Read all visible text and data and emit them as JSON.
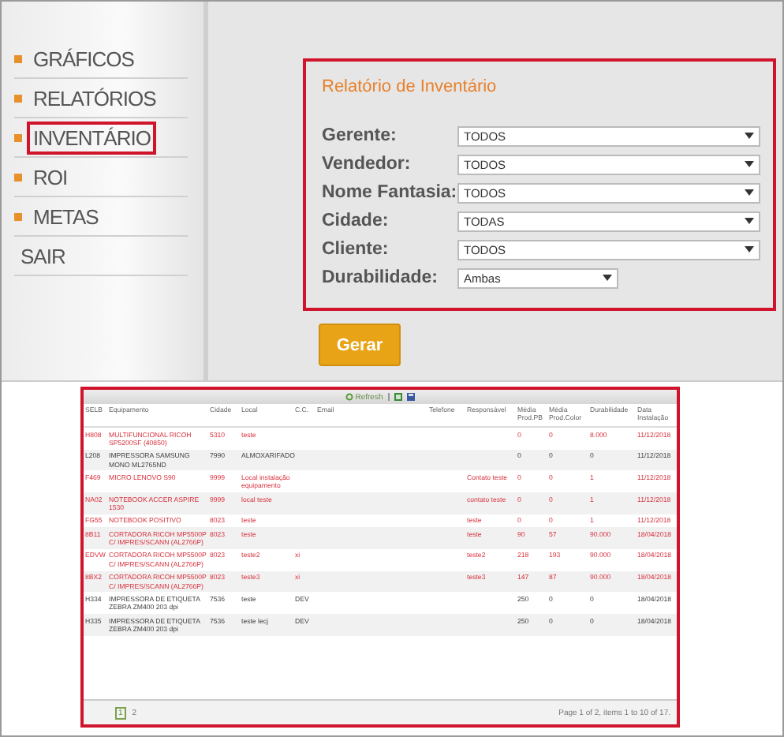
{
  "menu": [
    {
      "label": "GRÁFICOS",
      "bullet": true,
      "highlighted": false
    },
    {
      "label": "RELATÓRIOS",
      "bullet": true,
      "highlighted": false
    },
    {
      "label": "INVENTÁRIO",
      "bullet": true,
      "highlighted": true
    },
    {
      "label": "ROI",
      "bullet": true,
      "highlighted": false
    },
    {
      "label": "METAS",
      "bullet": true,
      "highlighted": false
    },
    {
      "label": "SAIR",
      "bullet": false,
      "highlighted": false
    }
  ],
  "form": {
    "title": "Relatório de Inventário",
    "highlighted": true,
    "fields": [
      {
        "label": "Gerente:",
        "value": "TODOS",
        "wide": true
      },
      {
        "label": "Vendedor:",
        "value": "TODOS",
        "wide": true
      },
      {
        "label": "Nome Fantasia:",
        "value": "TODOS",
        "wide": true
      },
      {
        "label": "Cidade:",
        "value": "TODAS",
        "wide": true
      },
      {
        "label": "Cliente:",
        "value": "TODOS",
        "wide": true
      },
      {
        "label": "Durabilidade:",
        "value": "Ambas",
        "wide": false
      }
    ],
    "button": "Gerar"
  },
  "grid": {
    "highlighted": true,
    "toolbar": {
      "refresh": "Refresh"
    },
    "columns": [
      "SELB",
      "Equipamento",
      "Cidade",
      "Local",
      "C.C.",
      "Email",
      "Telefone",
      "Responsável",
      "Média Prod.PB",
      "Média Prod.Color",
      "Durabilidade",
      "Data Instalação"
    ],
    "rows": [
      {
        "alert": true,
        "cells": [
          "H808",
          "MULTIFUNCIONAL RICOH SP5200SF (40850)",
          "5310",
          "teste",
          null,
          null,
          null,
          null,
          "0",
          "0",
          "8.000",
          "11/12/2018"
        ]
      },
      {
        "alert": false,
        "cells": [
          "L208",
          "IMPRESSORA SAMSUNG MONO ML2765ND",
          "7990",
          "ALMOXARIFADO",
          null,
          null,
          null,
          null,
          "0",
          "0",
          "0",
          "11/12/2018"
        ]
      },
      {
        "alert": true,
        "cells": [
          "F469",
          "MICRO LENOVO S90",
          "9999",
          "Local instalação equipamento",
          null,
          null,
          null,
          "Contato teste",
          "0",
          "0",
          "1",
          "11/12/2018"
        ]
      },
      {
        "alert": true,
        "cells": [
          "NA02",
          "NOTEBOOK ACCER ASPIRE 1530",
          "9999",
          "local teste",
          null,
          null,
          null,
          "contato teste",
          "0",
          "0",
          "1",
          "11/12/2018"
        ]
      },
      {
        "alert": true,
        "cells": [
          "FG55",
          "NOTEBOOK POSITIVO",
          "8023",
          "teste",
          null,
          null,
          null,
          "teste",
          "0",
          "0",
          "1",
          "11/12/2018"
        ]
      },
      {
        "alert": true,
        "cells": [
          "8B11",
          "CORTADORA RICOH MP5500P C/ IMPRES/SCANN (AL2766P)",
          "8023",
          "teste",
          null,
          null,
          null,
          "teste",
          "90",
          "57",
          "90.000",
          "18/04/2018"
        ]
      },
      {
        "alert": true,
        "cells": [
          "EDVW",
          "CORTADORA RICOH MP5500P C/ IMPRES/SCANN (AL2766P)",
          "8023",
          "teste2",
          "xi",
          null,
          null,
          "teste2",
          "218",
          "193",
          "90.000",
          "18/04/2018"
        ]
      },
      {
        "alert": true,
        "cells": [
          "8BX2",
          "CORTADORA RICOH MP5500P C/ IMPRES/SCANN (AL2766P)",
          "8023",
          "teste3",
          "xi",
          null,
          null,
          "teste3",
          "147",
          "87",
          "90.000",
          "18/04/2018"
        ]
      },
      {
        "alert": false,
        "cells": [
          "H334",
          "IMPRESSORA DE ETIQUETA ZEBRA ZM400 203 dpi",
          "7536",
          "teste",
          "DEV",
          null,
          null,
          null,
          "250",
          "0",
          "0",
          "18/04/2018"
        ]
      },
      {
        "alert": false,
        "cells": [
          "H335",
          "IMPRESSORA DE ETIQUETA ZEBRA ZM400 203 dpi",
          "7536",
          "teste lecj",
          "DEV",
          null,
          null,
          null,
          "250",
          "0",
          "0",
          "18/04/2018"
        ]
      }
    ],
    "pages": [
      {
        "label": "1",
        "selected": true
      },
      {
        "label": "2",
        "selected": false
      }
    ],
    "summary": "Page 1 of 2, items 1 to 10 of 17."
  }
}
